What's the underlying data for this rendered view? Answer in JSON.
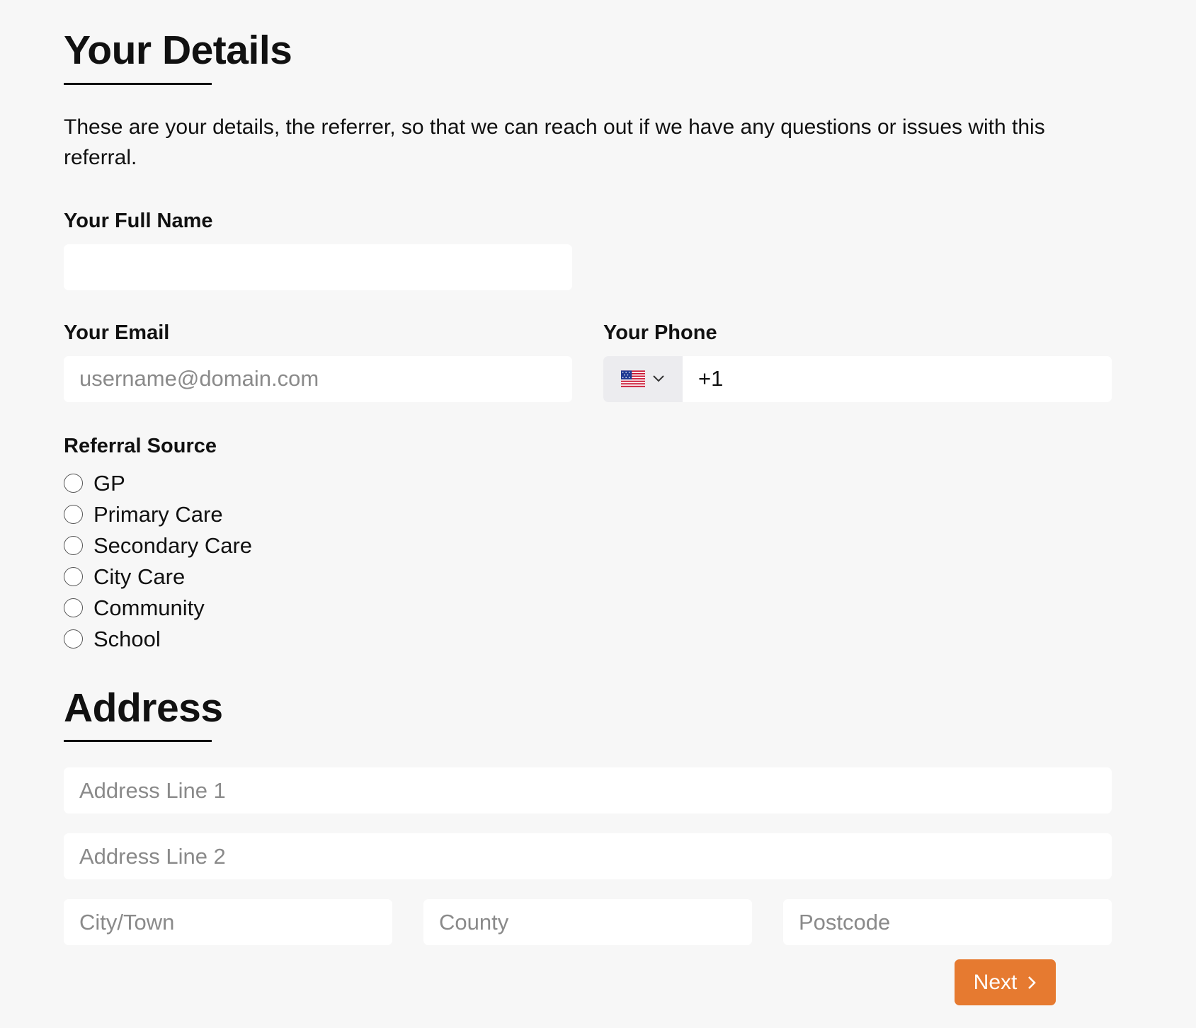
{
  "details": {
    "title": "Your Details",
    "intro": "These are your details, the referrer, so that we can reach out if we have any questions or issues with this referral.",
    "full_name": {
      "label": "Your Full Name",
      "value": "",
      "placeholder": ""
    },
    "email": {
      "label": "Your Email",
      "value": "",
      "placeholder": "username@domain.com"
    },
    "phone": {
      "label": "Your Phone",
      "country_icon": "us-flag-icon",
      "value": "+1"
    }
  },
  "referral": {
    "label": "Referral Source",
    "options": [
      "GP",
      "Primary Care",
      "Secondary Care",
      "City Care",
      "Community",
      "School"
    ]
  },
  "address": {
    "title": "Address",
    "line1": {
      "placeholder": "Address Line 1",
      "value": ""
    },
    "line2": {
      "placeholder": "Address Line 2",
      "value": ""
    },
    "city": {
      "placeholder": "City/Town",
      "value": ""
    },
    "county": {
      "placeholder": "County",
      "value": ""
    },
    "postcode": {
      "placeholder": "Postcode",
      "value": ""
    }
  },
  "actions": {
    "next_label": "Next"
  },
  "colors": {
    "accent": "#e67a30",
    "background": "#f7f7f7",
    "input_bg": "#ffffff"
  }
}
